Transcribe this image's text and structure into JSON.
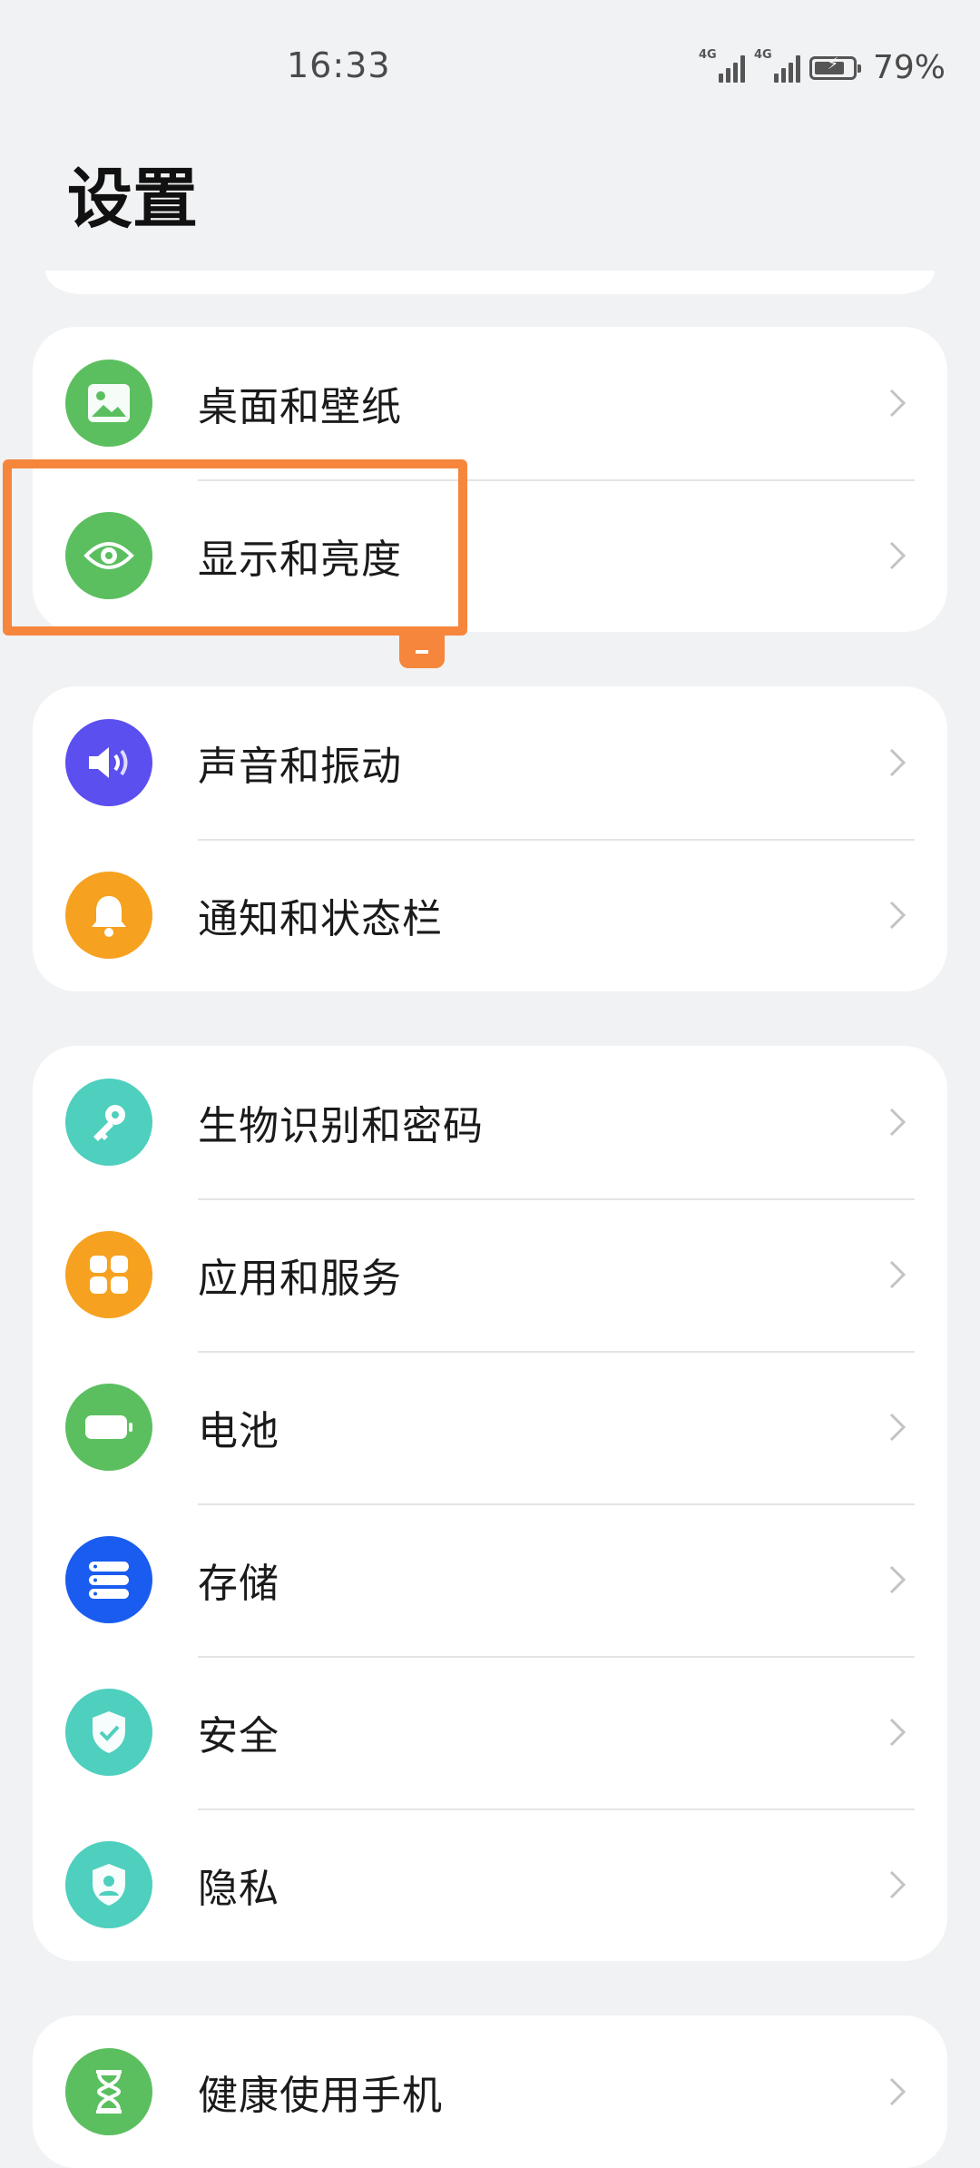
{
  "status_bar": {
    "time": "16:33",
    "signal_1_label": "4G",
    "signal_2_label": "4G",
    "battery_percent": "79%",
    "battery_level": 0.79
  },
  "page": {
    "title": "设置"
  },
  "groups": [
    {
      "items": [
        {
          "label": "桌面和壁纸",
          "icon": "wallpaper-icon",
          "color": "#5bbf5f"
        },
        {
          "label": "显示和亮度",
          "icon": "eye-icon",
          "color": "#5bbf5f"
        }
      ]
    },
    {
      "items": [
        {
          "label": "声音和振动",
          "icon": "speaker-icon",
          "color": "#5b4ff0"
        },
        {
          "label": "通知和状态栏",
          "icon": "bell-icon",
          "color": "#f6a11f"
        }
      ]
    },
    {
      "items": [
        {
          "label": "生物识别和密码",
          "icon": "key-icon",
          "color": "#4fcfbe"
        },
        {
          "label": "应用和服务",
          "icon": "apps-grid-icon",
          "color": "#f6a11f"
        },
        {
          "label": "电池",
          "icon": "battery-icon",
          "color": "#5bbf5f"
        },
        {
          "label": "存储",
          "icon": "storage-icon",
          "color": "#1a5cf0"
        },
        {
          "label": "安全",
          "icon": "shield-check-icon",
          "color": "#4fcfbe"
        },
        {
          "label": "隐私",
          "icon": "privacy-shield-icon",
          "color": "#4fcfbe"
        }
      ]
    },
    {
      "items": [
        {
          "label": "健康使用手机",
          "icon": "hourglass-icon",
          "color": "#5bbf5f"
        }
      ]
    }
  ],
  "colors": {
    "background": "#f1f2f4",
    "card": "#ffffff",
    "highlight": "#f5863c"
  }
}
